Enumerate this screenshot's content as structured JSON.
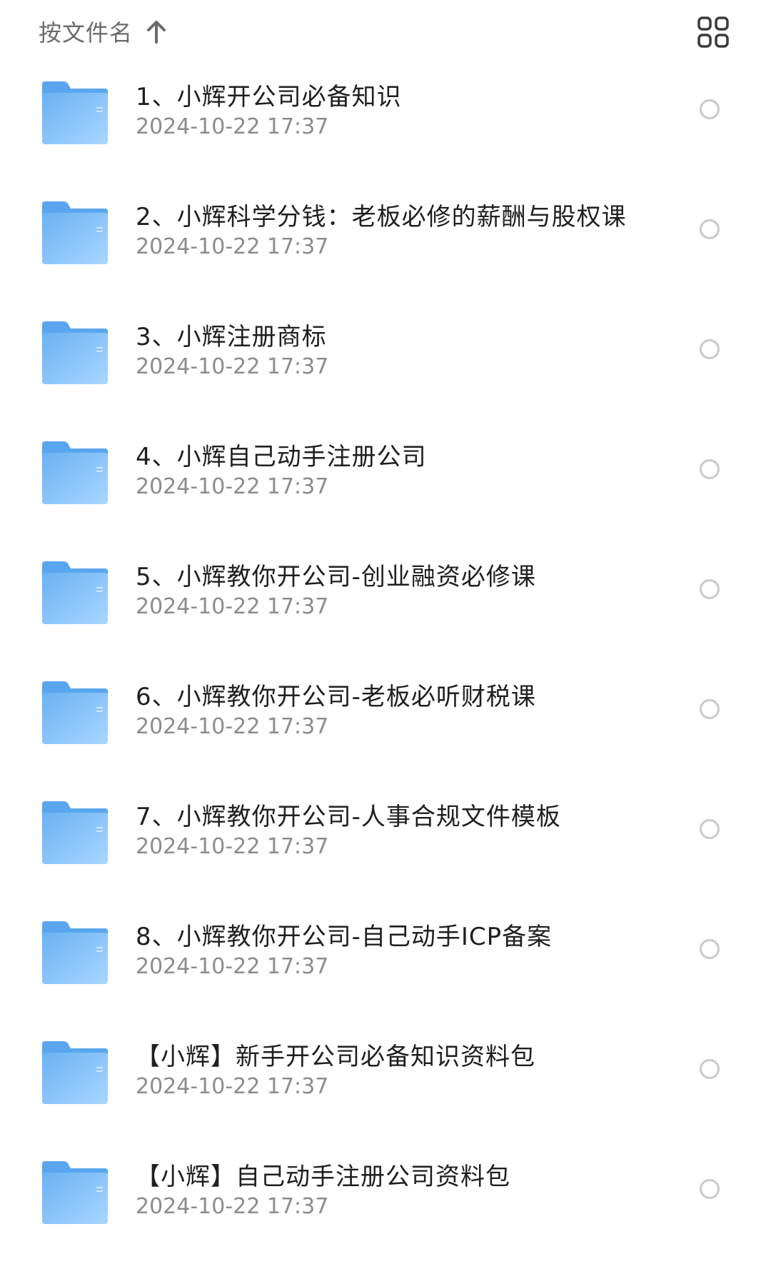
{
  "header": {
    "sort_label": "按文件名",
    "sort_icon": "arrow-up-icon",
    "view_icon": "grid-view-icon"
  },
  "colors": {
    "folder_light": "#9fd0ff",
    "folder_dark": "#5aa6ee",
    "date_text": "#8c8c8c",
    "title_text": "#1f1f1f"
  },
  "items": [
    {
      "name": "1、小辉开公司必备知识",
      "date": "2024-10-22 17:37"
    },
    {
      "name": "2、小辉科学分钱：老板必修的薪酬与股权课",
      "date": "2024-10-22 17:37"
    },
    {
      "name": "3、小辉注册商标",
      "date": "2024-10-22 17:37"
    },
    {
      "name": "4、小辉自己动手注册公司",
      "date": "2024-10-22 17:37"
    },
    {
      "name": "5、小辉教你开公司-创业融资必修课",
      "date": "2024-10-22 17:37"
    },
    {
      "name": "6、小辉教你开公司-老板必听财税课",
      "date": "2024-10-22 17:37"
    },
    {
      "name": "7、小辉教你开公司-人事合规文件模板",
      "date": "2024-10-22 17:37"
    },
    {
      "name": "8、小辉教你开公司-自己动手ICP备案",
      "date": "2024-10-22 17:37"
    },
    {
      "name": "【小辉】新手开公司必备知识资料包",
      "date": "2024-10-22 17:37"
    },
    {
      "name": "【小辉】自己动手注册公司资料包",
      "date": "2024-10-22 17:37"
    }
  ]
}
